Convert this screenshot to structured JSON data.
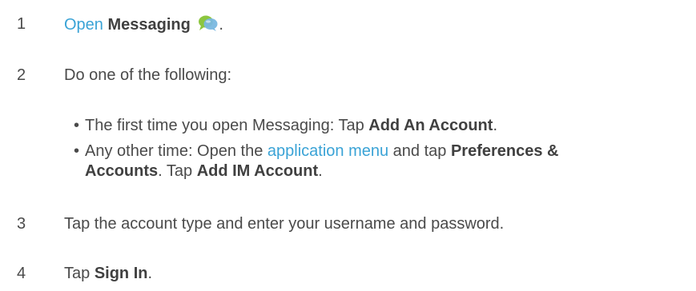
{
  "steps": [
    {
      "num": "1",
      "link": "Open",
      "bold": "Messaging",
      "end": "."
    },
    {
      "num": "2",
      "text": "Do one of the following:"
    },
    {
      "num": "3",
      "text": "Tap the account type and enter your username and password."
    },
    {
      "num": "4",
      "pre": "Tap ",
      "bold": "Sign In",
      "end": "."
    }
  ],
  "bullets": [
    {
      "bullet": "•",
      "pre": "The first time you open Messaging: Tap ",
      "bold": "Add An Account",
      "end": "."
    },
    {
      "bullet": "•",
      "pre": "Any other time: Open the ",
      "link": "application menu",
      "mid": " and tap ",
      "bold1": "Preferences &",
      "bold2": "Accounts",
      "mid2": ". Tap ",
      "bold3": "Add IM Account",
      "end": "."
    }
  ],
  "icons": {
    "messaging": "messaging-chat-bubbles-icon"
  },
  "colors": {
    "link": "#3aa3d6",
    "text": "#4a4a4a",
    "icon_green": "#8cc63f",
    "icon_blue": "#7ab8e0"
  }
}
